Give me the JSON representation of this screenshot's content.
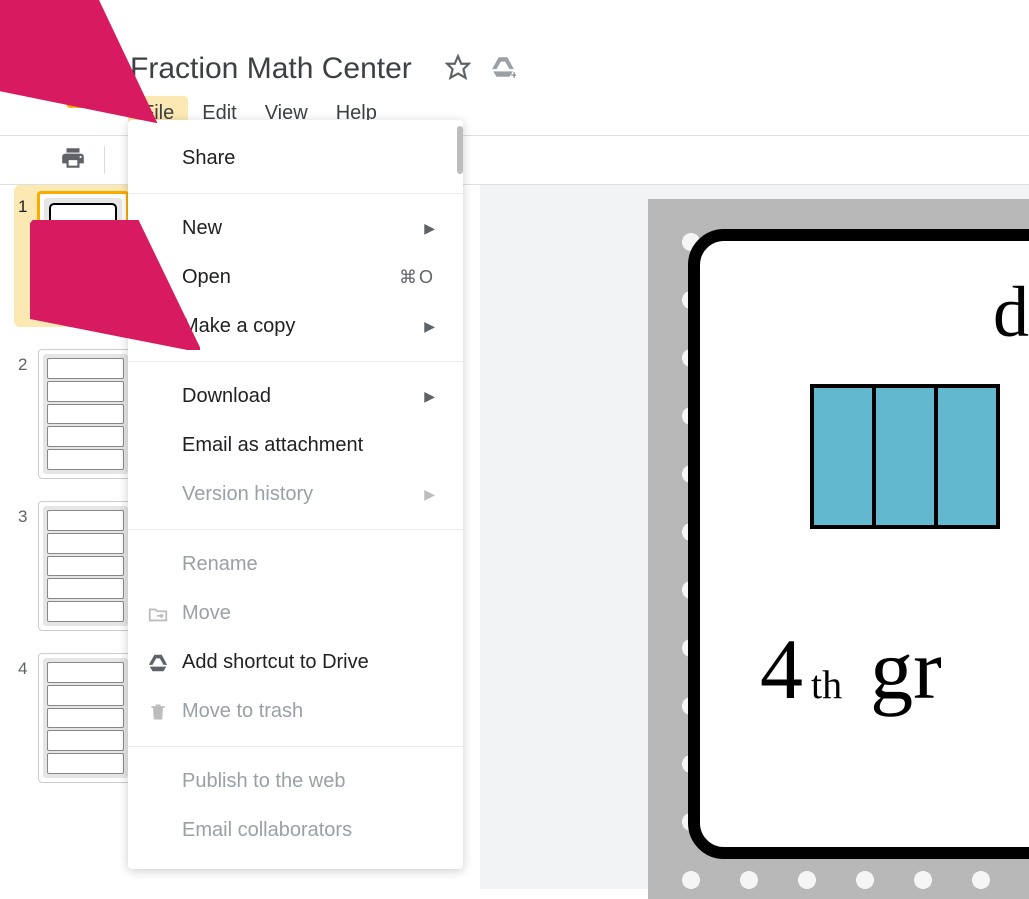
{
  "header": {
    "title": "Fraction Math Center"
  },
  "menubar": {
    "items": [
      {
        "label": "File",
        "active": true
      },
      {
        "label": "Edit",
        "active": false
      },
      {
        "label": "View",
        "active": false
      },
      {
        "label": "Help",
        "active": false
      }
    ]
  },
  "dropdown": {
    "items": [
      {
        "label": "Share",
        "type": "item"
      },
      {
        "type": "sep"
      },
      {
        "label": "New",
        "type": "submenu"
      },
      {
        "label": "Open",
        "type": "item",
        "shortcut": "⌘O"
      },
      {
        "label": "Make a copy",
        "type": "submenu"
      },
      {
        "type": "sep"
      },
      {
        "label": "Download",
        "type": "submenu"
      },
      {
        "label": "Email as attachment",
        "type": "item"
      },
      {
        "label": "Version history",
        "type": "submenu",
        "disabled": true
      },
      {
        "type": "sep"
      },
      {
        "label": "Rename",
        "type": "item",
        "disabled": true
      },
      {
        "label": "Move",
        "type": "item",
        "disabled": true,
        "icon": "move-icon"
      },
      {
        "label": "Add shortcut to Drive",
        "type": "item",
        "icon": "drive-icon"
      },
      {
        "label": "Move to trash",
        "type": "item",
        "disabled": true,
        "icon": "trash-icon"
      },
      {
        "type": "sep"
      },
      {
        "label": "Publish to the web",
        "type": "item",
        "disabled": true
      },
      {
        "label": "Email collaborators",
        "type": "item",
        "disabled": true
      }
    ]
  },
  "thumbnails": {
    "items": [
      {
        "num": "1",
        "selected": true
      },
      {
        "num": "2",
        "selected": false
      },
      {
        "num": "3",
        "selected": false
      },
      {
        "num": "4",
        "selected": false
      }
    ]
  },
  "slide": {
    "title_text": "digita",
    "grade_num": "4",
    "grade_sup": "th",
    "grade_rest": "gr"
  }
}
